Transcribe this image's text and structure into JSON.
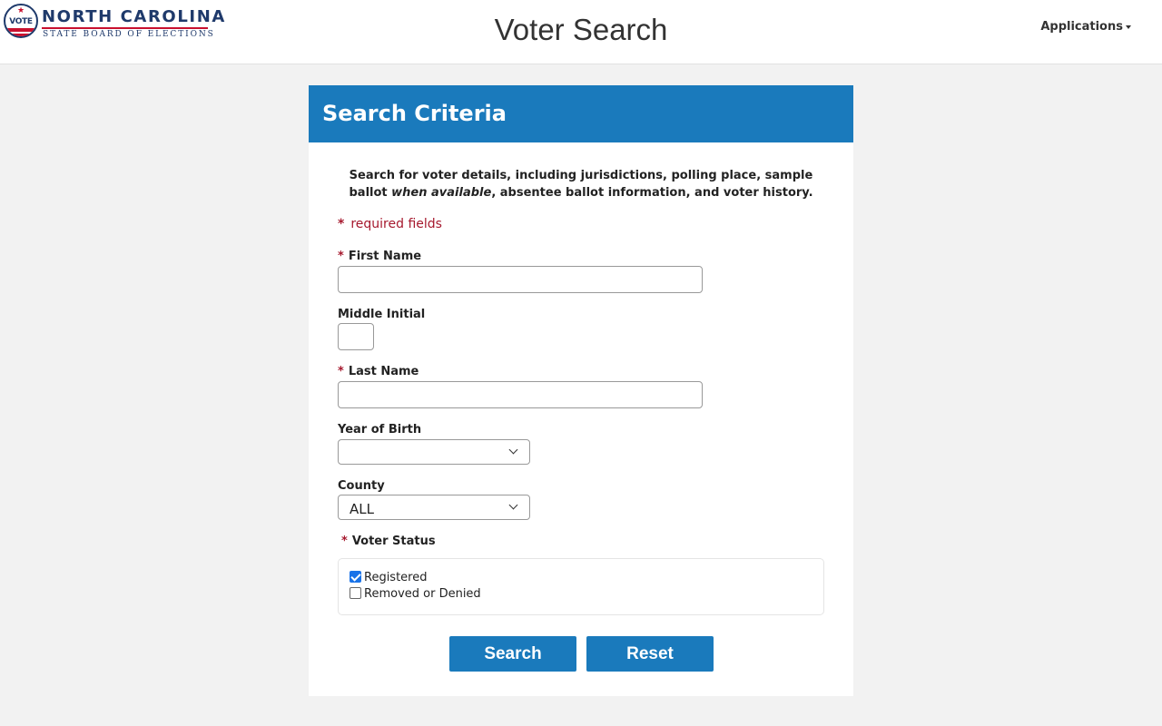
{
  "header": {
    "logo": {
      "seal_text": "VOTE",
      "title": "NORTH CAROLINA",
      "subtitle": "STATE BOARD OF ELECTIONS"
    },
    "page_title": "Voter Search",
    "applications_label": "Applications"
  },
  "card": {
    "title": "Search Criteria",
    "intro_part1": "Search for voter details, including jurisdictions, polling place, sample ballot ",
    "intro_em": "when available",
    "intro_part2": ", absentee ballot information, and voter history.",
    "required_star": "*",
    "required_note": "required fields"
  },
  "form": {
    "first_name": {
      "label": "First Name",
      "value": ""
    },
    "middle_initial": {
      "label": "Middle Initial",
      "value": ""
    },
    "last_name": {
      "label": "Last Name",
      "value": ""
    },
    "year_of_birth": {
      "label": "Year of Birth",
      "selected": ""
    },
    "county": {
      "label": "County",
      "selected": "ALL"
    },
    "voter_status": {
      "label": "Voter Status",
      "options": [
        {
          "label": "Registered",
          "checked": true
        },
        {
          "label": "Removed or Denied",
          "checked": false
        }
      ]
    }
  },
  "buttons": {
    "search": "Search",
    "reset": "Reset"
  },
  "colors": {
    "accent": "#1a7abc",
    "required": "#a6192e"
  }
}
